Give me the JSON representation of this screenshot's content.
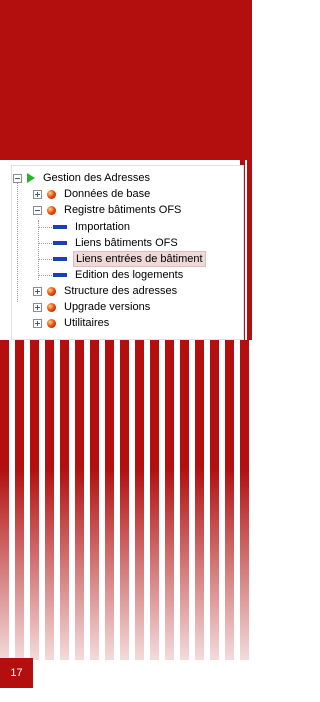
{
  "tree": {
    "root": {
      "label": "Gestion des Adresses",
      "icon": "green-play-icon"
    },
    "items": [
      {
        "label": "Données de base",
        "icon": "red-ball-icon",
        "expander": "plus"
      },
      {
        "label": "Registre bâtiments OFS",
        "icon": "red-ball-icon",
        "expander": "minus",
        "children": [
          {
            "label": "Importation",
            "icon": "blue-dash-icon"
          },
          {
            "label": "Liens bâtiments OFS",
            "icon": "blue-dash-icon"
          },
          {
            "label": "Liens entrées de bâtiment",
            "icon": "blue-dash-icon",
            "selected": true
          },
          {
            "label": "Edition des logements",
            "icon": "blue-dash-icon"
          }
        ]
      },
      {
        "label": "Structure des adresses",
        "icon": "red-ball-icon",
        "expander": "plus"
      },
      {
        "label": "Upgrade versions",
        "icon": "red-ball-icon",
        "expander": "plus"
      },
      {
        "label": "Utilitaires",
        "icon": "red-ball-icon",
        "expander": "plus"
      }
    ]
  },
  "footer": {
    "page_number": "17"
  },
  "colors": {
    "brand_red": "#b30f0f",
    "selection_bg": "#efd8d8",
    "play_green": "#25b425",
    "leaf_blue": "#1a3fb8"
  }
}
